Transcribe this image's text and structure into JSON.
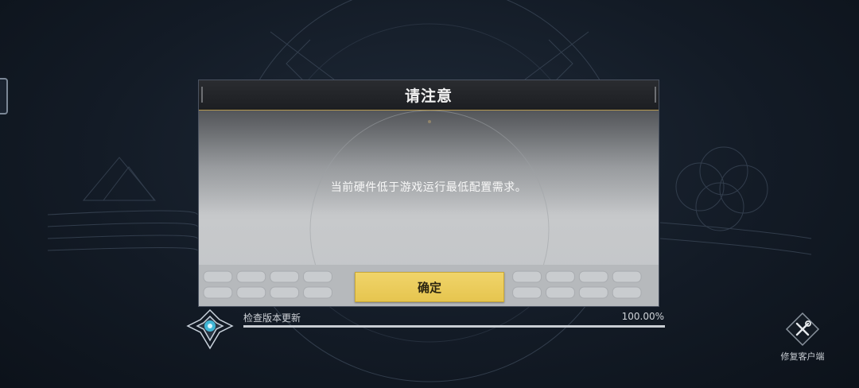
{
  "dialog": {
    "title": "请注意",
    "message": "当前硬件低于游戏运行最低配置需求。",
    "confirm_label": "确定"
  },
  "progress": {
    "label": "检查版本更新",
    "percent_text": "100.00%",
    "value": 1.0
  },
  "repair": {
    "label": "修复客户端",
    "icon": "wrench-screwdriver-icon"
  },
  "colors": {
    "accent_gold": "#e6c54f",
    "header_line": "#b89b52",
    "background": "#131b26"
  }
}
